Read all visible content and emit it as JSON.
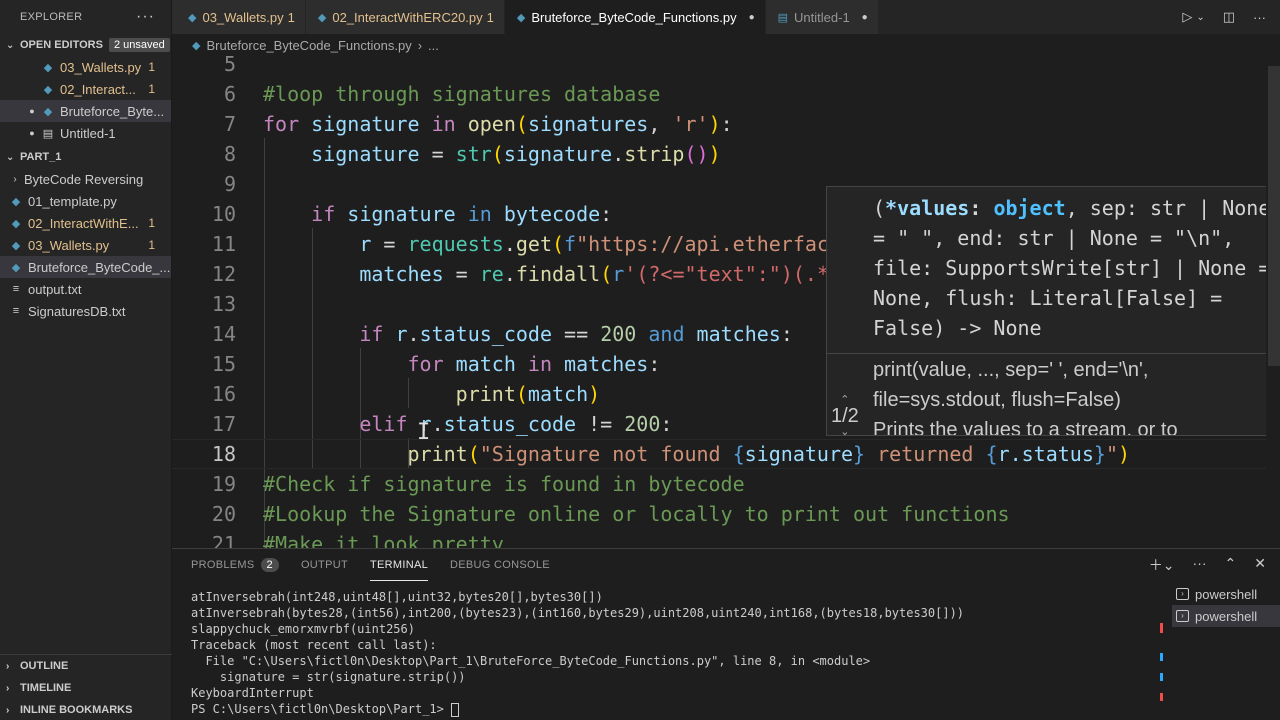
{
  "explorer": {
    "title": "EXPLORER",
    "more_label": "···",
    "open_editors": {
      "heading": "OPEN EDITORS",
      "badge": "2 unsaved",
      "items": [
        {
          "label": "03_Wallets.py",
          "count": "1",
          "dot": "",
          "icon": "python-file-icon"
        },
        {
          "label": "02_Interact...",
          "count": "1",
          "dot": "",
          "icon": "python-file-icon"
        },
        {
          "label": "Bruteforce_Byte...",
          "count": "",
          "dot": "●",
          "icon": "python-file-icon"
        },
        {
          "label": "Untitled-1",
          "count": "",
          "dot": "●",
          "icon": "untitled-file-icon"
        }
      ]
    },
    "workspace": {
      "heading": "PART_1",
      "items": [
        {
          "label": "ByteCode Reversing",
          "type": "folder"
        },
        {
          "label": "01_template.py",
          "type": "file",
          "count": ""
        },
        {
          "label": "02_InteractWithE...",
          "type": "file",
          "count": "1"
        },
        {
          "label": "03_Wallets.py",
          "type": "file",
          "count": "1"
        },
        {
          "label": "Bruteforce_ByteCode_...",
          "type": "file",
          "count": ""
        },
        {
          "label": "output.txt",
          "type": "text",
          "count": ""
        },
        {
          "label": "SignaturesDB.txt",
          "type": "text",
          "count": ""
        }
      ]
    },
    "bottom_sections": [
      "OUTLINE",
      "TIMELINE",
      "INLINE BOOKMARKS"
    ]
  },
  "tabs": [
    {
      "label": "03_Wallets.py",
      "count": "1",
      "dirty": false
    },
    {
      "label": "02_InteractWithERC20.py",
      "count": "1",
      "dirty": false
    },
    {
      "label": "Bruteforce_ByteCode_Functions.py",
      "count": "",
      "dirty": true
    },
    {
      "label": "Untitled-1",
      "count": "",
      "dirty": true
    }
  ],
  "breadcrumb": {
    "file": "Bruteforce_ByteCode_Functions.py",
    "sep": "›",
    "rest": "..."
  },
  "editor": {
    "current_line": "18",
    "lines": [
      {
        "n": "5",
        "tokens": []
      },
      {
        "n": "6",
        "tokens": [
          {
            "t": "#loop through signatures database",
            "c": "#6a9955"
          }
        ]
      },
      {
        "n": "7",
        "tokens": [
          {
            "t": "for",
            "c": "#c586c0"
          },
          {
            "t": " signature ",
            "c": "#9cdcfe"
          },
          {
            "t": "in",
            "c": "#c586c0"
          },
          {
            "t": " ",
            "c": "#d4d4d4"
          },
          {
            "t": "open",
            "c": "#dcdcaa"
          },
          {
            "t": "(",
            "c": "#ffd700"
          },
          {
            "t": "signatures",
            "c": "#9cdcfe"
          },
          {
            "t": ", ",
            "c": "#d4d4d4"
          },
          {
            "t": "'r'",
            "c": "#ce9178"
          },
          {
            "t": ")",
            "c": "#ffd700"
          },
          {
            "t": ":",
            "c": "#d4d4d4"
          }
        ]
      },
      {
        "n": "8",
        "tokens": [
          {
            "t": "    signature",
            "c": "#9cdcfe"
          },
          {
            "t": " = ",
            "c": "#d4d4d4"
          },
          {
            "t": "str",
            "c": "#4ec9b0"
          },
          {
            "t": "(",
            "c": "#ffd700"
          },
          {
            "t": "signature",
            "c": "#9cdcfe"
          },
          {
            "t": ".",
            "c": "#d4d4d4"
          },
          {
            "t": "strip",
            "c": "#dcdcaa"
          },
          {
            "t": "()",
            "c": "#da70d6"
          },
          {
            "t": ")",
            "c": "#ffd700"
          }
        ]
      },
      {
        "n": "9",
        "tokens": []
      },
      {
        "n": "10",
        "tokens": [
          {
            "t": "    if",
            "c": "#c586c0"
          },
          {
            "t": " signature ",
            "c": "#9cdcfe"
          },
          {
            "t": "in",
            "c": "#569cd6"
          },
          {
            "t": " bytecode",
            "c": "#9cdcfe"
          },
          {
            "t": ":",
            "c": "#d4d4d4"
          }
        ]
      },
      {
        "n": "11",
        "tokens": [
          {
            "t": "        r",
            "c": "#9cdcfe"
          },
          {
            "t": " = ",
            "c": "#d4d4d4"
          },
          {
            "t": "requests",
            "c": "#4ec9b0"
          },
          {
            "t": ".",
            "c": "#d4d4d4"
          },
          {
            "t": "get",
            "c": "#dcdcaa"
          },
          {
            "t": "(",
            "c": "#ffd700"
          },
          {
            "t": "f",
            "c": "#569cd6"
          },
          {
            "t": "\"https://api.etherfac",
            "c": "#ce9178"
          }
        ]
      },
      {
        "n": "12",
        "tokens": [
          {
            "t": "        matches",
            "c": "#9cdcfe"
          },
          {
            "t": " = ",
            "c": "#d4d4d4"
          },
          {
            "t": "re",
            "c": "#4ec9b0"
          },
          {
            "t": ".",
            "c": "#d4d4d4"
          },
          {
            "t": "findall",
            "c": "#dcdcaa"
          },
          {
            "t": "(",
            "c": "#ffd700"
          },
          {
            "t": "r",
            "c": "#569cd6"
          },
          {
            "t": "'(?<=\"text\":\")(.*",
            "c": "#d16969"
          }
        ]
      },
      {
        "n": "13",
        "tokens": []
      },
      {
        "n": "14",
        "tokens": [
          {
            "t": "        if",
            "c": "#c586c0"
          },
          {
            "t": " r",
            "c": "#9cdcfe"
          },
          {
            "t": ".",
            "c": "#d4d4d4"
          },
          {
            "t": "status_code",
            "c": "#9cdcfe"
          },
          {
            "t": " == ",
            "c": "#d4d4d4"
          },
          {
            "t": "200",
            "c": "#b5cea8"
          },
          {
            "t": " ",
            "c": "#d4d4d4"
          },
          {
            "t": "and",
            "c": "#569cd6"
          },
          {
            "t": " matches",
            "c": "#9cdcfe"
          },
          {
            "t": ":",
            "c": "#d4d4d4"
          }
        ]
      },
      {
        "n": "15",
        "tokens": [
          {
            "t": "            for",
            "c": "#c586c0"
          },
          {
            "t": " match ",
            "c": "#9cdcfe"
          },
          {
            "t": "in",
            "c": "#c586c0"
          },
          {
            "t": " matches",
            "c": "#9cdcfe"
          },
          {
            "t": ":",
            "c": "#d4d4d4"
          }
        ]
      },
      {
        "n": "16",
        "tokens": [
          {
            "t": "                print",
            "c": "#dcdcaa"
          },
          {
            "t": "(",
            "c": "#ffd700"
          },
          {
            "t": "match",
            "c": "#9cdcfe"
          },
          {
            "t": ")",
            "c": "#ffd700"
          }
        ]
      },
      {
        "n": "17",
        "tokens": [
          {
            "t": "        elif",
            "c": "#c586c0"
          },
          {
            "t": " r",
            "c": "#9cdcfe"
          },
          {
            "t": ".",
            "c": "#d4d4d4"
          },
          {
            "t": "status_code",
            "c": "#9cdcfe"
          },
          {
            "t": " != ",
            "c": "#d4d4d4"
          },
          {
            "t": "200",
            "c": "#b5cea8"
          },
          {
            "t": ":",
            "c": "#d4d4d4"
          }
        ]
      },
      {
        "n": "18",
        "tokens": [
          {
            "t": "            print",
            "c": "#dcdcaa"
          },
          {
            "t": "(",
            "c": "#ffd700"
          },
          {
            "t": "\"Signature not found ",
            "c": "#ce9178"
          },
          {
            "t": "{",
            "c": "#569cd6"
          },
          {
            "t": "signature",
            "c": "#9cdcfe"
          },
          {
            "t": "}",
            "c": "#569cd6"
          },
          {
            "t": " returned ",
            "c": "#ce9178"
          },
          {
            "t": "{",
            "c": "#569cd6"
          },
          {
            "t": "r.status",
            "c": "#9cdcfe"
          },
          {
            "t": "}",
            "c": "#569cd6"
          },
          {
            "t": "\"",
            "c": "#ce9178"
          },
          {
            "t": ")",
            "c": "#ffd700"
          }
        ]
      },
      {
        "n": "19",
        "tokens": [
          {
            "t": "#Check if signature is found in bytecode",
            "c": "#6a9955"
          }
        ]
      },
      {
        "n": "20",
        "tokens": [
          {
            "t": "#Lookup the Signature online or locally to print out functions",
            "c": "#6a9955"
          }
        ]
      },
      {
        "n": "21",
        "tokens": [
          {
            "t": "#Make it look pretty",
            "c": "#6a9955"
          }
        ]
      }
    ]
  },
  "hover": {
    "signature_tokens": [
      {
        "t": "(",
        "c": "#d4d4d4"
      },
      {
        "t": "*values",
        "c": "#9cdcfe",
        "b": true
      },
      {
        "t": ": ",
        "c": "#d4d4d4",
        "b": true
      },
      {
        "t": "object",
        "c": "#4fc1ff",
        "b": true
      },
      {
        "t": ", sep: str | None = \" \", end: str | None = \"\\n\", file: SupportsWrite[str] | None = None, flush: Literal[False] = False) -> None",
        "c": "#d4d4d4"
      }
    ],
    "doc": "print(value, ..., sep=' ', end='\\n', file=sys.stdout, flush=False)",
    "doc_more": "Prints the values to a stream, or to",
    "overload": "1/2"
  },
  "panel": {
    "tabs": [
      {
        "label": "PROBLEMS",
        "badge": "2"
      },
      {
        "label": "OUTPUT",
        "badge": ""
      },
      {
        "label": "TERMINAL",
        "badge": ""
      },
      {
        "label": "DEBUG CONSOLE",
        "badge": ""
      }
    ],
    "active_tab": "TERMINAL",
    "terminal_lines": [
      "atInversebrah(int248,uint48[],uint32,bytes20[],bytes30[])",
      "atInversebrah(bytes28,(int56),int200,(bytes23),(int160,bytes29),uint208,uint240,int168,(bytes18,bytes30[]))",
      "slappychuck_emorxmvrbf(uint256)",
      "Traceback (most recent call last):",
      "  File \"C:\\Users\\fictl0n\\Desktop\\Part_1\\BruteForce_ByteCode_Functions.py\", line 8, in <module>",
      "    signature = str(signature.strip())",
      "KeyboardInterrupt"
    ],
    "prompt": "PS C:\\Users\\fictl0n\\Desktop\\Part_1> ",
    "terminals": [
      "powershell",
      "powershell"
    ]
  }
}
